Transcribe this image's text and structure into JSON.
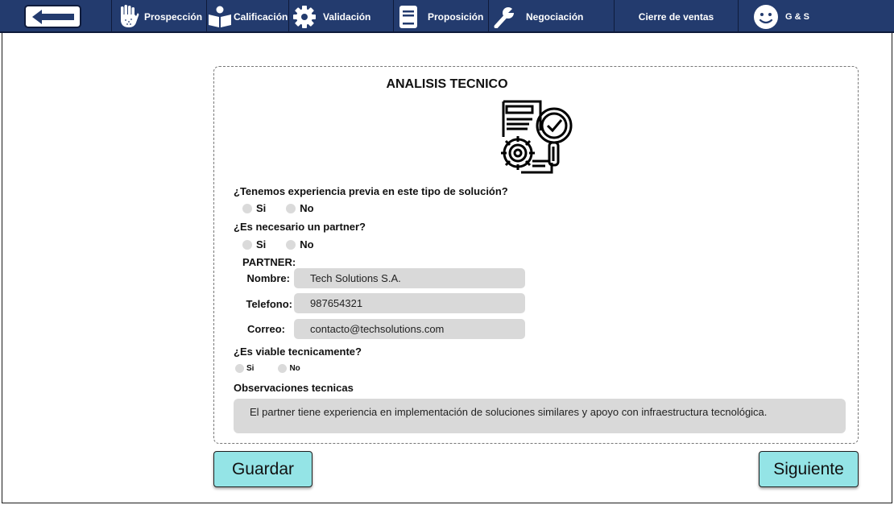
{
  "nav": {
    "items": [
      {
        "label": "Prospección",
        "icon": "hand-icon"
      },
      {
        "label": "Calificación",
        "icon": "reader-icon"
      },
      {
        "label": "Validación",
        "icon": "gear-icon"
      },
      {
        "label": "Proposición",
        "icon": "document-icon"
      },
      {
        "label": "Negociación",
        "icon": "wrench-icon"
      },
      {
        "label": "Cierre de ventas",
        "icon": ""
      },
      {
        "label": "G & S",
        "icon": "smiley-icon"
      }
    ],
    "color": "#233b6e"
  },
  "form": {
    "title": "ANALISIS TECNICO",
    "q1": {
      "label": "¿Tenemos experiencia previa en este tipo de solución?",
      "yes": "Si",
      "no": "No"
    },
    "q2": {
      "label": "¿Es necesario un partner?",
      "yes": "Si",
      "no": "No"
    },
    "partner": {
      "heading": "PARTNER:",
      "name_label": "Nombre:",
      "name_value": "Tech Solutions S.A.",
      "phone_label": "Telefono:",
      "phone_value": "987654321",
      "email_label": "Correo:",
      "email_value": "contacto@techsolutions.com"
    },
    "q3": {
      "label": "¿Es viable tecnicamente?",
      "yes": "Si",
      "no": "No"
    },
    "observations": {
      "label": "Observaciones tecnicas",
      "value": "El partner tiene experiencia en implementación de soluciones similares y apoyo con infraestructura tecnológica."
    }
  },
  "buttons": {
    "save": "Guardar",
    "next": "Siguiente",
    "button_color": "#94e4e6"
  }
}
